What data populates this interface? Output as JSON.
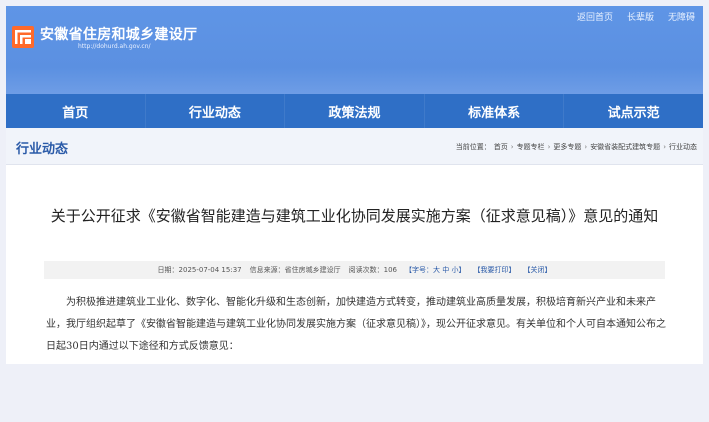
{
  "header": {
    "site_title": "安徽省住房和城乡建设厅",
    "site_url": "http://dohurd.ah.gov.cn/",
    "toplinks": [
      "返回首页",
      "长辈版",
      "无障碍"
    ]
  },
  "nav": [
    "首页",
    "行业动态",
    "政策法规",
    "标准体系",
    "试点示范"
  ],
  "breadcrumb": {
    "section": "行业动态",
    "prefix": "当前位置：",
    "items": [
      "首页",
      "专题专栏",
      "更多专题",
      "安徽省装配式建筑专题",
      "行业动态"
    ]
  },
  "article": {
    "title": "关于公开征求《安徽省智能建造与建筑工业化协同发展实施方案（征求意见稿）》意见的通知",
    "meta": {
      "date": "日期：2025-07-04 15:37",
      "source": "信息来源：省住房城乡建设厅",
      "views_label": "阅读次数：",
      "views": "106",
      "font_size": "【字号：大 中 小】",
      "print": "【我要打印】",
      "close": "【关闭】"
    },
    "body": "为积极推进建筑业工业化、数字化、智能化升级和生态创新，加快建造方式转变，推动建筑业高质量发展，积极培育新兴产业和未来产业，我厅组织起草了《安徽省智能建造与建筑工业化协同发展实施方案（征求意见稿）》，现公开征求意见。有关单位和个人可自本通知公布之日起30日内通过以下途径和方式反馈意见："
  },
  "colors": {
    "banner": "#5f95e6",
    "nav": "#2f6fc6",
    "logo": "#ff6a2a",
    "section_title": "#2a5aa8"
  }
}
